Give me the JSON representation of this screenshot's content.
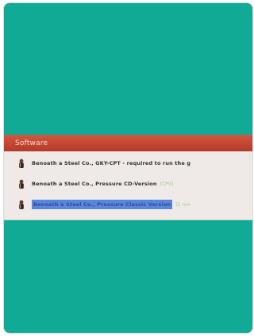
{
  "window": {
    "background_color": "#10aa95",
    "header_color": "#c64b34"
  },
  "panel": {
    "header_label": "Software",
    "items": [
      {
        "label": "Benoath a Steel Co., GKY-CPT - required to run the g",
        "extra": "",
        "selected": false,
        "icon": "package-icon"
      },
      {
        "label": "Benoath a Steel Co., Pressure CD-Version",
        "extra": "(CPV)",
        "selected": false,
        "icon": "package-icon"
      },
      {
        "label": "Benoath a Steel Co., Pressure Classic Version",
        "extra": "(1 run",
        "selected": true,
        "icon": "package-icon"
      }
    ]
  }
}
